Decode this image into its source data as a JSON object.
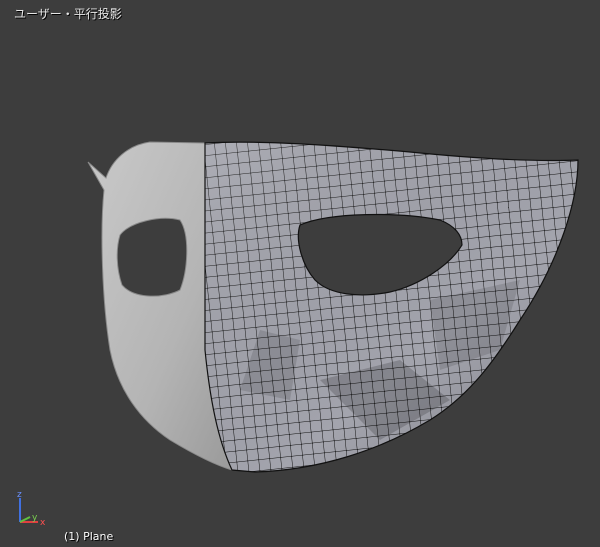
{
  "viewport": {
    "view_label": "ユーザー・平行投影",
    "object_label": "(1) Plane"
  },
  "axes": {
    "z_label": "z",
    "y_label": "y",
    "x_label": "x",
    "colors": {
      "x": "#e04040",
      "y": "#60c040",
      "z": "#4070e0"
    }
  },
  "colors": {
    "background": "#3d3d3d",
    "mesh_shaded": "#b8b8b8",
    "mesh_wire_face": "#9fa0aa",
    "wire": "#111111"
  }
}
